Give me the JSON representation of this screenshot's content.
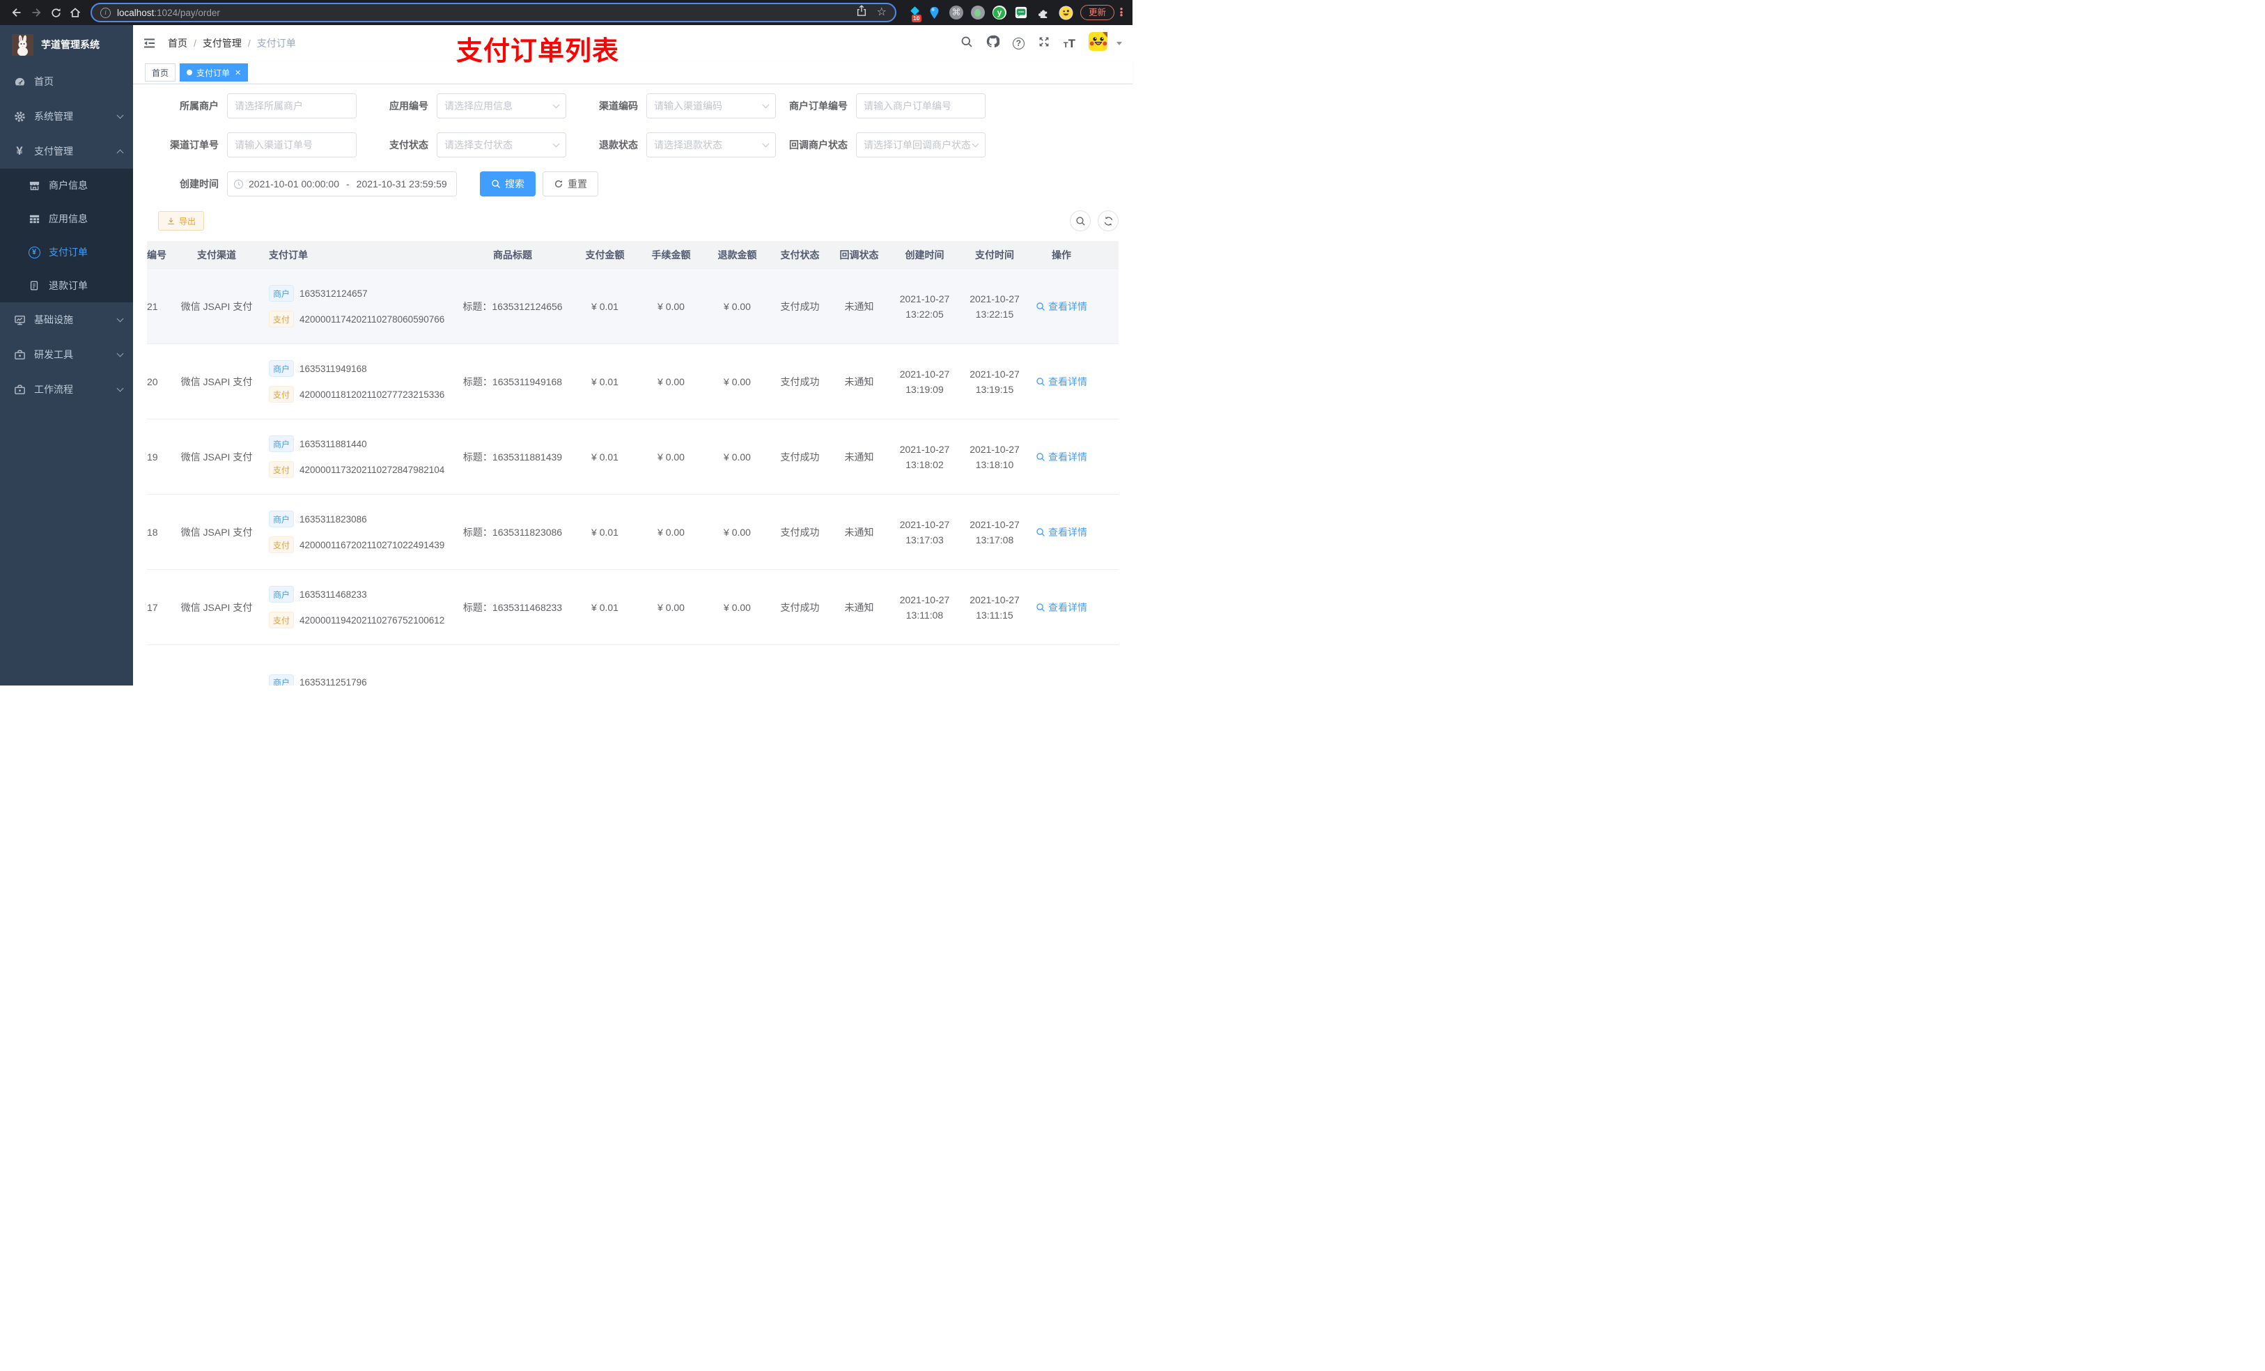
{
  "browser": {
    "url_host": "localhost",
    "url_rest": ":1024/pay/order",
    "ext_badge": "10",
    "update_label": "更新"
  },
  "sidebar": {
    "app_title": "芋道管理系统",
    "items": [
      {
        "name": "home",
        "label": "首页",
        "icon": "gauge-icon",
        "level": 1
      },
      {
        "name": "system-mgmt",
        "label": "系统管理",
        "icon": "gear-icon",
        "level": 1,
        "chevron": "down"
      },
      {
        "name": "payment-mgmt",
        "label": "支付管理",
        "icon": "yen-icon",
        "level": 1,
        "chevron": "up"
      },
      {
        "name": "merchant-info",
        "label": "商户信息",
        "icon": "shop-icon",
        "level": 2
      },
      {
        "name": "app-info",
        "label": "应用信息",
        "icon": "grid-icon",
        "level": 2
      },
      {
        "name": "pay-order",
        "label": "支付订单",
        "icon": "yen-circle-icon",
        "level": 2,
        "active": true
      },
      {
        "name": "refund-order",
        "label": "退款订单",
        "icon": "file-icon",
        "level": 2
      },
      {
        "name": "infrastructure",
        "label": "基础设施",
        "icon": "monitor-icon",
        "level": 1,
        "chevron": "down"
      },
      {
        "name": "dev-tools",
        "label": "研发工具",
        "icon": "toolbox-icon",
        "level": 1,
        "chevron": "down"
      },
      {
        "name": "workflow",
        "label": "工作流程",
        "icon": "toolbox-icon",
        "level": 1,
        "chevron": "down"
      }
    ]
  },
  "header": {
    "breadcrumb": [
      "首页",
      "支付管理",
      "支付订单"
    ],
    "annotation": "支付订单列表"
  },
  "tabs": [
    {
      "label": "首页",
      "active": false
    },
    {
      "label": "支付订单",
      "active": true
    }
  ],
  "filters": {
    "rows": [
      [
        {
          "name": "merchant",
          "label": "所属商户",
          "placeholder": "请选择所属商户",
          "select": false
        },
        {
          "name": "app-no",
          "label": "应用编号",
          "placeholder": "请选择应用信息",
          "select": true
        },
        {
          "name": "channel-code",
          "label": "渠道编码",
          "placeholder": "请输入渠道编码",
          "select": true
        },
        {
          "name": "merchant-order-no",
          "label": "商户订单编号",
          "placeholder": "请输入商户订单编号",
          "select": false
        }
      ],
      [
        {
          "name": "channel-order-no",
          "label": "渠道订单号",
          "placeholder": "请输入渠道订单号",
          "select": false
        },
        {
          "name": "pay-status",
          "label": "支付状态",
          "placeholder": "请选择支付状态",
          "select": true
        },
        {
          "name": "refund-status",
          "label": "退款状态",
          "placeholder": "请选择退款状态",
          "select": true
        },
        {
          "name": "notify-status",
          "label": "回调商户状态",
          "placeholder": "请选择订单回调商户状态",
          "select": true
        }
      ]
    ],
    "date": {
      "label": "创建时间",
      "start": "2021-10-01 00:00:00",
      "separator": "-",
      "end": "2021-10-31 23:59:59"
    },
    "search_label": "搜索",
    "reset_label": "重置"
  },
  "toolbar": {
    "export_label": "导出"
  },
  "table": {
    "headers": [
      "编号",
      "支付渠道",
      "支付订单",
      "商品标题",
      "支付金额",
      "手续金额",
      "退款金额",
      "支付状态",
      "回调状态",
      "创建时间",
      "支付时间",
      "操作"
    ],
    "tag_merchant": "商户",
    "tag_pay": "支付",
    "action_label": "查看详情",
    "rows": [
      {
        "id": "21",
        "channel": "微信 JSAPI 支付",
        "merchant_no": "1635312124657",
        "pay_no": "4200001174202110278060590766",
        "title": "标题：1635312124656",
        "amount": "¥ 0.01",
        "fee": "¥ 0.00",
        "refund": "¥ 0.00",
        "pay_status": "支付成功",
        "notify_status": "未通知",
        "create_date": "2021-10-27",
        "create_time": "13:22:05",
        "pay_date": "2021-10-27",
        "pay_time": "13:22:15",
        "highlight": true
      },
      {
        "id": "20",
        "channel": "微信 JSAPI 支付",
        "merchant_no": "1635311949168",
        "pay_no": "4200001181202110277723215336",
        "title": "标题：1635311949168",
        "amount": "¥ 0.01",
        "fee": "¥ 0.00",
        "refund": "¥ 0.00",
        "pay_status": "支付成功",
        "notify_status": "未通知",
        "create_date": "2021-10-27",
        "create_time": "13:19:09",
        "pay_date": "2021-10-27",
        "pay_time": "13:19:15"
      },
      {
        "id": "19",
        "channel": "微信 JSAPI 支付",
        "merchant_no": "1635311881440",
        "pay_no": "4200001173202110272847982104",
        "title": "标题：1635311881439",
        "amount": "¥ 0.01",
        "fee": "¥ 0.00",
        "refund": "¥ 0.00",
        "pay_status": "支付成功",
        "notify_status": "未通知",
        "create_date": "2021-10-27",
        "create_time": "13:18:02",
        "pay_date": "2021-10-27",
        "pay_time": "13:18:10"
      },
      {
        "id": "18",
        "channel": "微信 JSAPI 支付",
        "merchant_no": "1635311823086",
        "pay_no": "4200001167202110271022491439",
        "title": "标题：1635311823086",
        "amount": "¥ 0.01",
        "fee": "¥ 0.00",
        "refund": "¥ 0.00",
        "pay_status": "支付成功",
        "notify_status": "未通知",
        "create_date": "2021-10-27",
        "create_time": "13:17:03",
        "pay_date": "2021-10-27",
        "pay_time": "13:17:08"
      },
      {
        "id": "17",
        "channel": "微信 JSAPI 支付",
        "merchant_no": "1635311468233",
        "pay_no": "4200001194202110276752100612",
        "title": "标题：1635311468233",
        "amount": "¥ 0.01",
        "fee": "¥ 0.00",
        "refund": "¥ 0.00",
        "pay_status": "支付成功",
        "notify_status": "未通知",
        "create_date": "2021-10-27",
        "create_time": "13:11:08",
        "pay_date": "2021-10-27",
        "pay_time": "13:11:15"
      },
      {
        "id": "",
        "channel": "",
        "merchant_no": "1635311251796",
        "pay_no": "",
        "title": "",
        "amount": "",
        "fee": "",
        "refund": "",
        "pay_status": "",
        "notify_status": "",
        "create_date": "",
        "create_time": "",
        "pay_date": "",
        "pay_time": "",
        "partial": true
      }
    ]
  },
  "colors": {
    "accent": "#409eff",
    "warning": "#e6a23c",
    "annotation_red": "#fb0300"
  }
}
